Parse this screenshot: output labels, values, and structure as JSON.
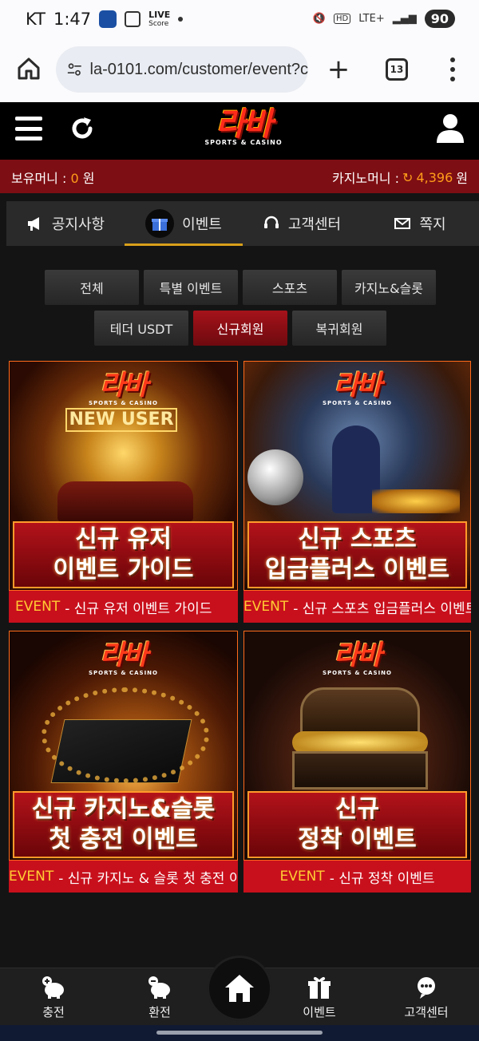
{
  "status_bar": {
    "carrier": "KT",
    "time": "1:47",
    "live_label": "LIVE",
    "live_sub": "Score",
    "network": "LTE+",
    "battery": "90"
  },
  "browser": {
    "url": "la-0101.com/customer/event?c",
    "tab_count": "13"
  },
  "header": {
    "logo_main": "라바",
    "logo_sub": "SPORTS & CASINO"
  },
  "money": {
    "label_left": "보유머니 :",
    "value_left": "0",
    "unit_left": "원",
    "label_right": "카지노머니 :",
    "value_right": "4,396",
    "unit_right": "원"
  },
  "nav_tabs": [
    {
      "label": "공지사항",
      "icon": "megaphone-icon"
    },
    {
      "label": "이벤트",
      "icon": "gift-icon",
      "active": true
    },
    {
      "label": "고객센터",
      "icon": "headset-icon"
    },
    {
      "label": "쪽지",
      "icon": "mail-icon"
    }
  ],
  "categories": [
    {
      "label": "전체"
    },
    {
      "label": "특별 이벤트"
    },
    {
      "label": "스포츠"
    },
    {
      "label": "카지노&슬롯"
    },
    {
      "label": "테더 USDT"
    },
    {
      "label": "신규회원",
      "active": true
    },
    {
      "label": "복귀회원"
    }
  ],
  "events": [
    {
      "banner_line1": "신규 유저",
      "banner_line2": "이벤트 가이드",
      "tag": "EVENT",
      "caption": "- 신규 유저 이벤트 가이드"
    },
    {
      "banner_line1": "신규 스포츠",
      "banner_line2": "입금플러스 이벤트",
      "tag": "EVENT",
      "caption": "- 신규 스포츠 입금플러스 이벤트"
    },
    {
      "banner_line1": "신규 카지노&슬롯",
      "banner_line2": "첫 충전 이벤트",
      "tag": "EVENT",
      "caption": "- 신규 카지노 & 슬롯 첫 충전 이벤트"
    },
    {
      "banner_line1": "신규",
      "banner_line2": "정착 이벤트",
      "tag": "EVENT",
      "caption": "- 신규 정착 이벤트"
    }
  ],
  "bottom_nav": [
    {
      "label": "충전",
      "icon": "deposit-icon"
    },
    {
      "label": "환전",
      "icon": "withdraw-icon"
    },
    {
      "label": "이벤트",
      "icon": "gift-icon"
    },
    {
      "label": "고객센터",
      "icon": "support-icon"
    }
  ],
  "colors": {
    "brand_red": "#c8101c",
    "money_bar": "#7d0e13",
    "accent_orange": "#ff9d1a",
    "event_tag": "#ffcc33"
  }
}
